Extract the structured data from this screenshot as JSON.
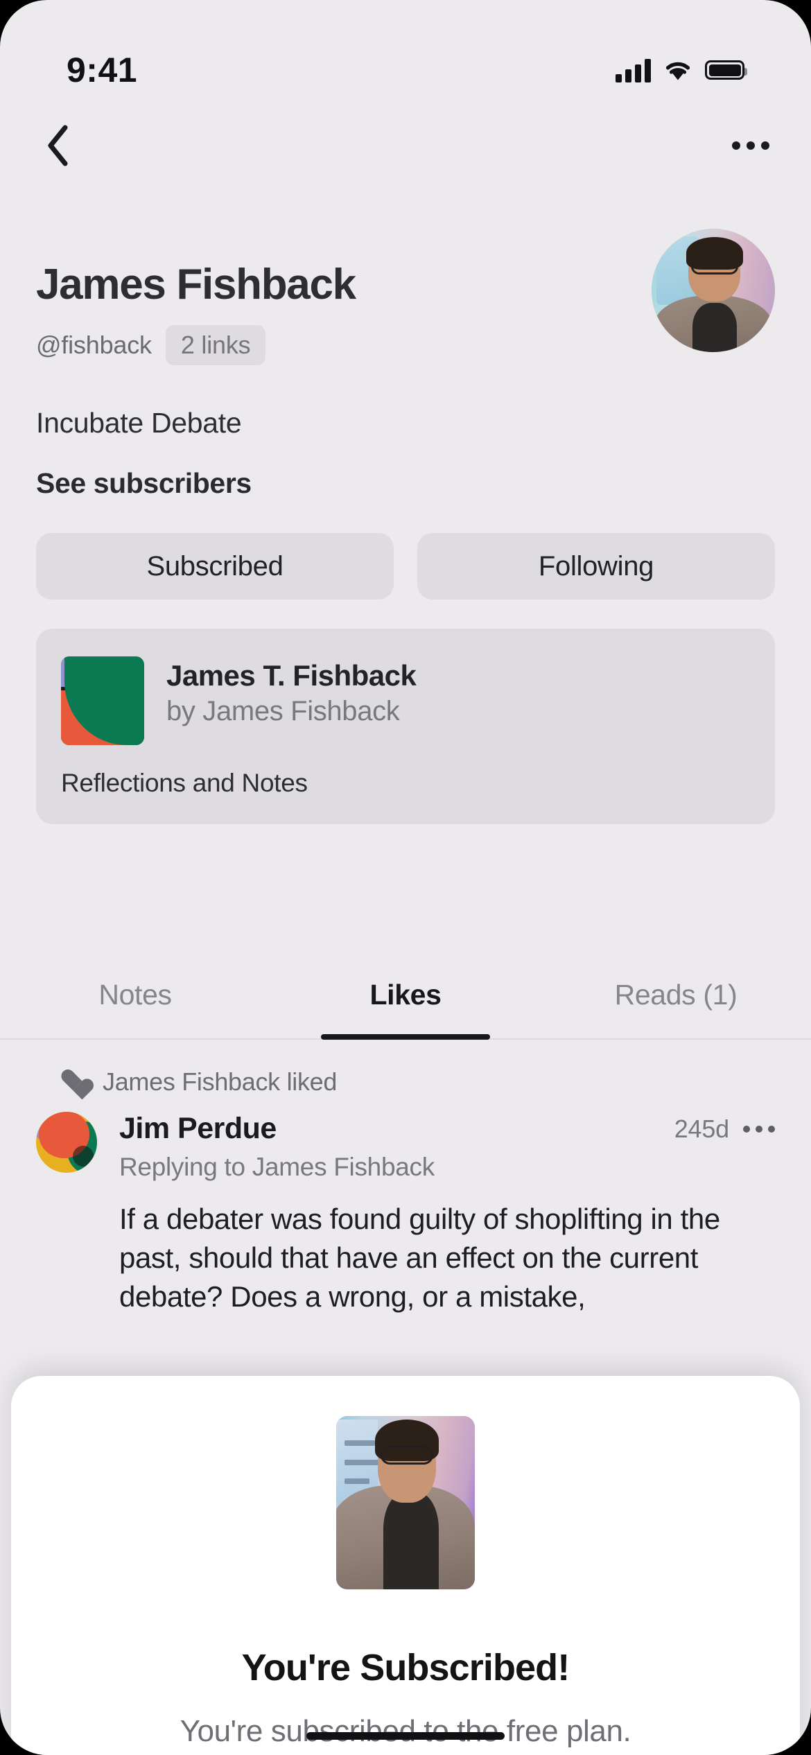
{
  "status_bar": {
    "time": "9:41",
    "cellular_icon": "cellular-signal-icon",
    "wifi_icon": "wifi-icon",
    "battery_icon": "battery-full-icon"
  },
  "nav": {
    "back_icon": "chevron-left-icon",
    "more_icon": "ellipsis-horizontal-icon"
  },
  "profile": {
    "display_name": "James Fishback",
    "handle": "@fishback",
    "links_badge": "2 links",
    "bio": "Incubate Debate",
    "see_subscribers": "See subscribers",
    "avatar_icon": "profile-avatar-photo",
    "actions": [
      {
        "label": "Subscribed"
      },
      {
        "label": "Following"
      }
    ]
  },
  "publication": {
    "logo_icon": "publication-logo",
    "title": "James T. Fishback",
    "byline": "by James Fishback",
    "subtitle": "Reflections and Notes"
  },
  "tabs": [
    {
      "label": "Notes",
      "active": false
    },
    {
      "label": "Likes",
      "active": true
    },
    {
      "label": "Reads (1)",
      "active": false
    }
  ],
  "note": {
    "liked_icon": "heart-filled-icon",
    "liked_by": "James Fishback liked",
    "avatar_icon": "note-author-avatar",
    "author": "Jim Perdue",
    "timestamp": "245d",
    "more_icon": "ellipsis-horizontal-icon",
    "replying_to": "Replying to James Fishback",
    "body": "If a debater was found guilty of shoplifting in the past, should that have an effect on the current debate? Does a wrong, or a mistake,"
  },
  "sheet": {
    "image_icon": "subscription-hero-photo",
    "title": "You're Subscribed!",
    "subtitle": "You're subscribed to the free plan."
  },
  "colors": {
    "background": "#ECEAED",
    "surface": "#DEDCE0",
    "sheet": "#FFFFFF",
    "text_primary": "#1E1E21",
    "text_secondary": "#78787E",
    "accent_green": "#0B7A53",
    "accent_orange": "#E7593A",
    "accent_yellow": "#EFA925",
    "accent_purple": "#8E93CF"
  }
}
